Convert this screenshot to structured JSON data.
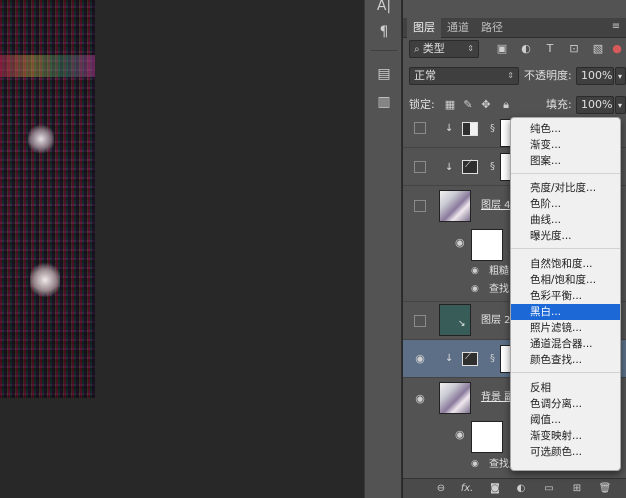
{
  "tabs": [
    {
      "label": "图层",
      "active": true
    },
    {
      "label": "通道",
      "active": false
    },
    {
      "label": "路径",
      "active": false
    }
  ],
  "filter": {
    "label": "类型"
  },
  "blend": {
    "mode": "正常",
    "opacity_label": "不透明度:",
    "opacity_value": "100%"
  },
  "lock": {
    "label": "锁定:",
    "fill_label": "填充:",
    "fill_value": "100%"
  },
  "layers": {
    "layer4_name": "图层 4",
    "layer4_fx1": "粗糙",
    "layer4_fx2": "查找",
    "layer2_name": "图层 2",
    "bg_name": "背景 副",
    "bg_fx": "查找边缘"
  },
  "menu": {
    "items_group1": [
      "纯色...",
      "渐变...",
      "图案..."
    ],
    "items_group2": [
      "亮度/对比度...",
      "色阶...",
      "曲线...",
      "曝光度..."
    ],
    "items_group3": [
      "自然饱和度...",
      "色相/饱和度...",
      "色彩平衡...",
      "黑白...",
      "照片滤镜...",
      "通道混合器...",
      "颜色查找..."
    ],
    "items_group4": [
      "反相",
      "色调分离...",
      "阈值...",
      "渐变映射...",
      "可选颜色..."
    ],
    "highlighted": "黑白..."
  },
  "bottom": {
    "fx_label": "fx."
  },
  "colors": {
    "highlight": "#1c68d6",
    "selected_layer": "#5c6f86",
    "panel": "#535353"
  }
}
